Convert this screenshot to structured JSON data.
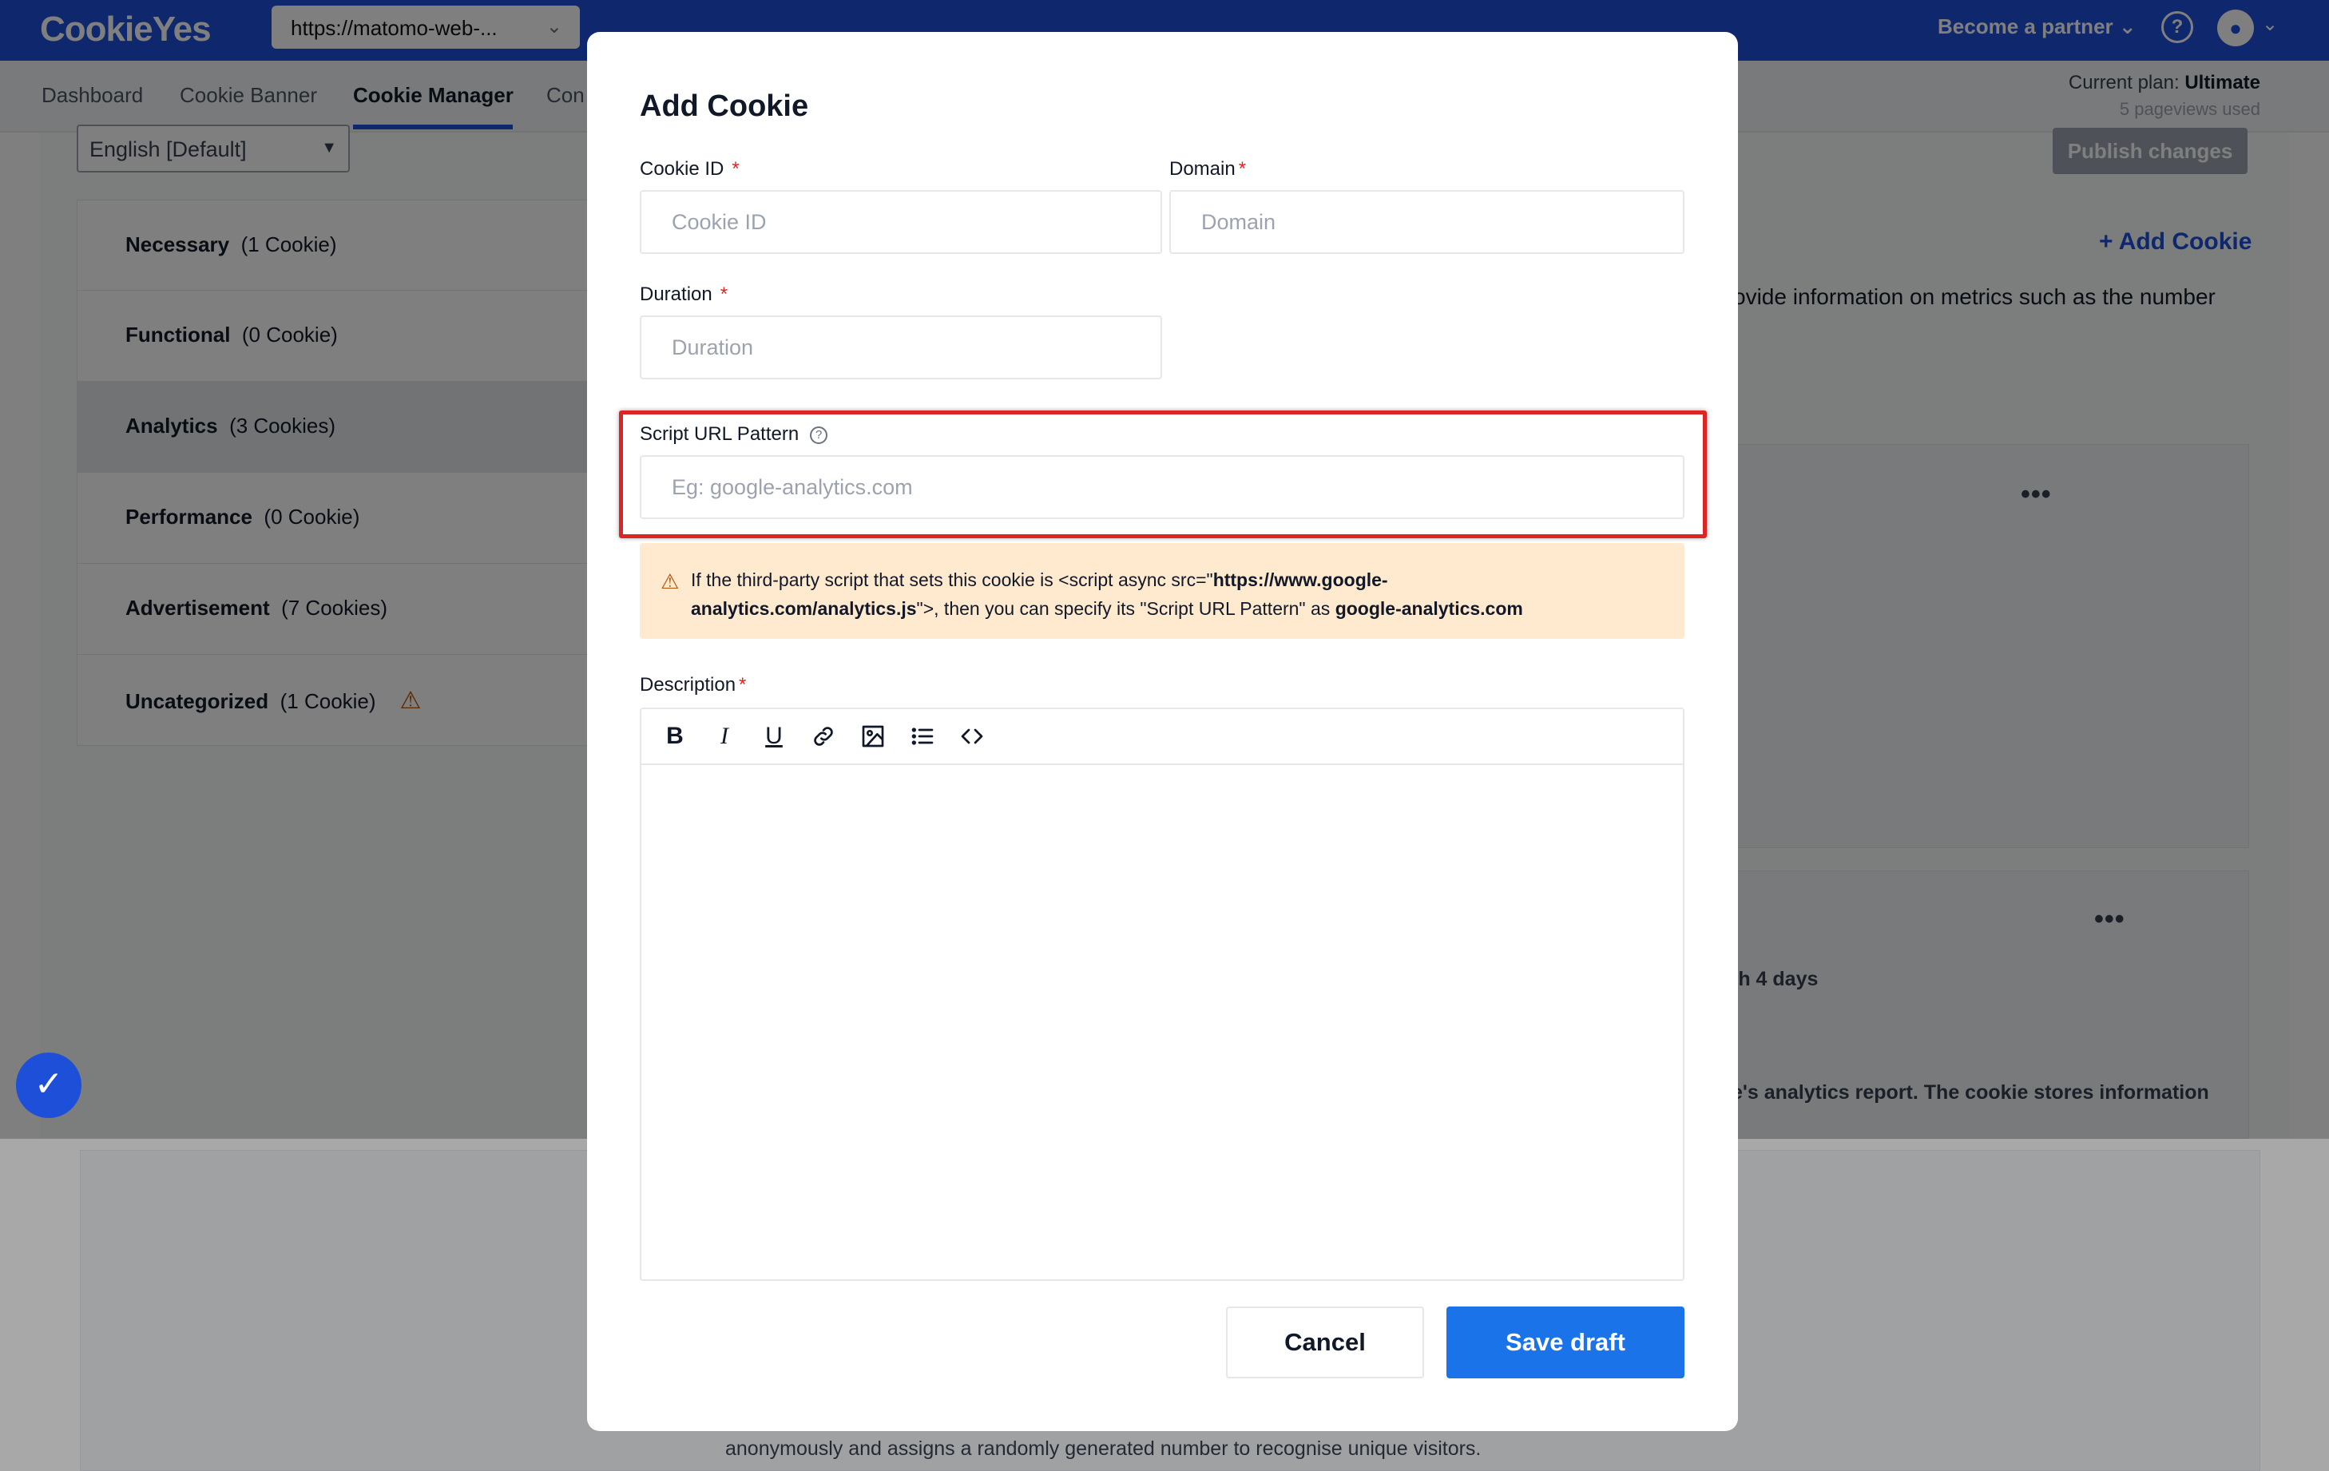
{
  "header": {
    "logo": "CookieYes",
    "site_url": "https://matomo-web-...",
    "become_partner": "Become a partner"
  },
  "subnav": {
    "tabs": [
      {
        "label": "Dashboard"
      },
      {
        "label": "Cookie Banner"
      },
      {
        "label": "Cookie Manager"
      },
      {
        "label": "Con"
      }
    ],
    "plan_label": "Current plan:",
    "plan_name": "Ultimate",
    "pageviews": "5 pageviews used"
  },
  "content": {
    "language": "English [Default]",
    "publish_button": "Publish changes",
    "add_cookie_link": "+ Add Cookie",
    "desc_fragment": "ovide information on metrics such as the number",
    "card_days": "th 4 days",
    "card_report": "e's analytics report. The cookie stores information",
    "bottom_text": "anonymously and assigns a randomly generated number to recognise unique visitors.",
    "categories": [
      {
        "name": "Necessary",
        "count": "(1 Cookie)"
      },
      {
        "name": "Functional",
        "count": "(0 Cookie)"
      },
      {
        "name": "Analytics",
        "count": "(3 Cookies)"
      },
      {
        "name": "Performance",
        "count": "(0 Cookie)"
      },
      {
        "name": "Advertisement",
        "count": "(7 Cookies)"
      },
      {
        "name": "Uncategorized",
        "count": "(1 Cookie)"
      }
    ]
  },
  "modal": {
    "title": "Add Cookie",
    "cookie_id_label": "Cookie ID",
    "cookie_id_placeholder": "Cookie ID",
    "domain_label": "Domain",
    "domain_placeholder": "Domain",
    "duration_label": "Duration",
    "duration_placeholder": "Duration",
    "script_url_label": "Script URL Pattern",
    "script_url_placeholder": "Eg: google-analytics.com",
    "required_mark": "*",
    "notice": {
      "part1": "If the third-party script that sets this cookie is <script async src=\"",
      "url_line1": "https://www.google-",
      "url_line2": "analytics.com/analytics.js",
      "part2": "\">, then you can specify its \"Script URL Pattern\" as ",
      "pattern": "google-analytics.com"
    },
    "description_label": "Description",
    "cancel_button": "Cancel",
    "save_button": "Save draft"
  }
}
